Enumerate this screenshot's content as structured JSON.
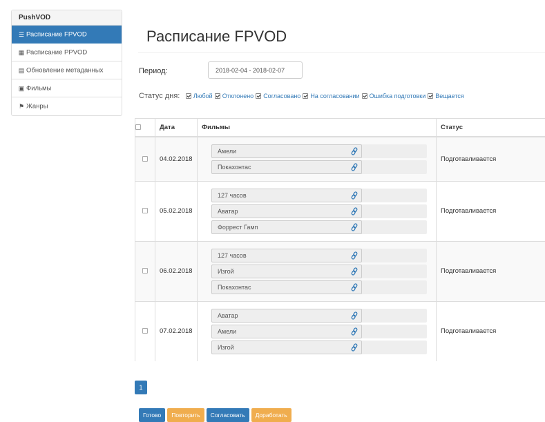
{
  "sidebar": {
    "title": "PushVOD",
    "items": [
      {
        "label": "Расписание FPVOD",
        "icon": "☰",
        "icon_name": "list-icon",
        "active": true
      },
      {
        "label": "Расписание PPVOD",
        "icon": "▦",
        "icon_name": "grid-icon",
        "active": false
      },
      {
        "label": "Обновление метаданных",
        "icon": "▤",
        "icon_name": "tasks-icon",
        "active": false
      },
      {
        "label": "Фильмы",
        "icon": "▣",
        "icon_name": "film-icon",
        "active": false
      },
      {
        "label": "Жанры",
        "icon": "⚑",
        "icon_name": "flag-icon",
        "active": false
      }
    ]
  },
  "page": {
    "title": "Расписание FPVOD"
  },
  "period": {
    "label": "Период:",
    "value": "2018-02-04 - 2018-02-07"
  },
  "status_filter": {
    "label": "Статус дня:",
    "options": [
      "Любой",
      "Отклонено",
      "Согласовано",
      "На согласовании",
      "Ошибка подготовки",
      "Вещается"
    ]
  },
  "table": {
    "headers": {
      "date": "Дата",
      "films": "Фильмы",
      "status": "Статус"
    },
    "rows": [
      {
        "date": "04.02.2018",
        "films": [
          "Амели",
          "Покахонтас"
        ],
        "status": "Подготавливается"
      },
      {
        "date": "05.02.2018",
        "films": [
          "127 часов",
          "Аватар",
          "Форрест Гамп"
        ],
        "status": "Подготавливается"
      },
      {
        "date": "06.02.2018",
        "films": [
          "127 часов",
          "Изгой",
          "Покахонтас"
        ],
        "status": "Подготавливается"
      },
      {
        "date": "07.02.2018",
        "films": [
          "Аватар",
          "Амели",
          "Изгой"
        ],
        "status": "Подготавливается"
      }
    ]
  },
  "pagination": {
    "current": "1"
  },
  "actions": {
    "done": "Готово",
    "repeat": "Повторить",
    "approve": "Согласовать",
    "rework": "Доработать"
  },
  "colors": {
    "primary": "#337ab7",
    "warning": "#f0ad4e"
  }
}
